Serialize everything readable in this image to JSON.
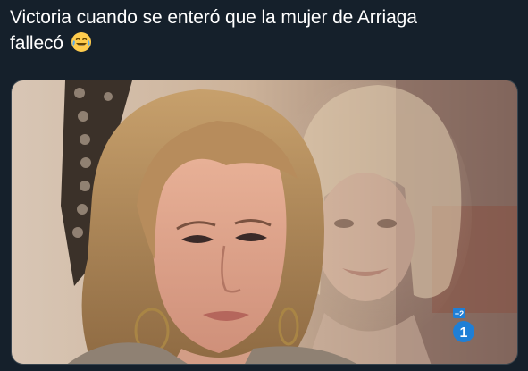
{
  "tweet": {
    "text_line1": "Victoria cuando se enteró que la mujer de Arriaga",
    "text_line2": "fallecó",
    "emoji": "face-with-tears-of-joy-icon"
  },
  "media": {
    "alt": "Video still",
    "channel_badge_top": "+2",
    "channel_badge_number": "1"
  },
  "colors": {
    "background": "#15202b",
    "text": "#ffffff",
    "media_border": "#38444d",
    "badge_blue": "#1f7fd6"
  }
}
